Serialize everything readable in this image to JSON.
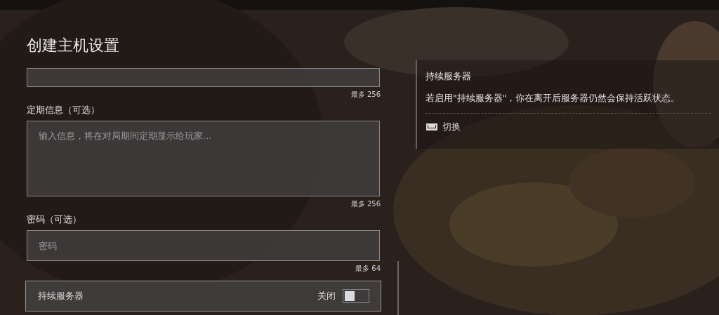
{
  "title": "创建主机设置",
  "fields": [
    {
      "kind": "input",
      "counter": "最多 256"
    },
    {
      "kind": "textarea",
      "label": "定期信息（可选）",
      "placeholder": "输入信息，将在对局期间定期显示给玩家...",
      "counter": "最多 256"
    },
    {
      "kind": "input",
      "label": "密码（可选）",
      "placeholder": "密码",
      "counter": "最多 64"
    }
  ],
  "toggle": {
    "label": "持续服务器",
    "state_text": "关闭",
    "on": false
  },
  "info_panel": {
    "title": "持续服务器",
    "text": "若启用\"持续服务器\"，你在离开后服务器仍然会保持活跃状态。",
    "action": "切换"
  }
}
